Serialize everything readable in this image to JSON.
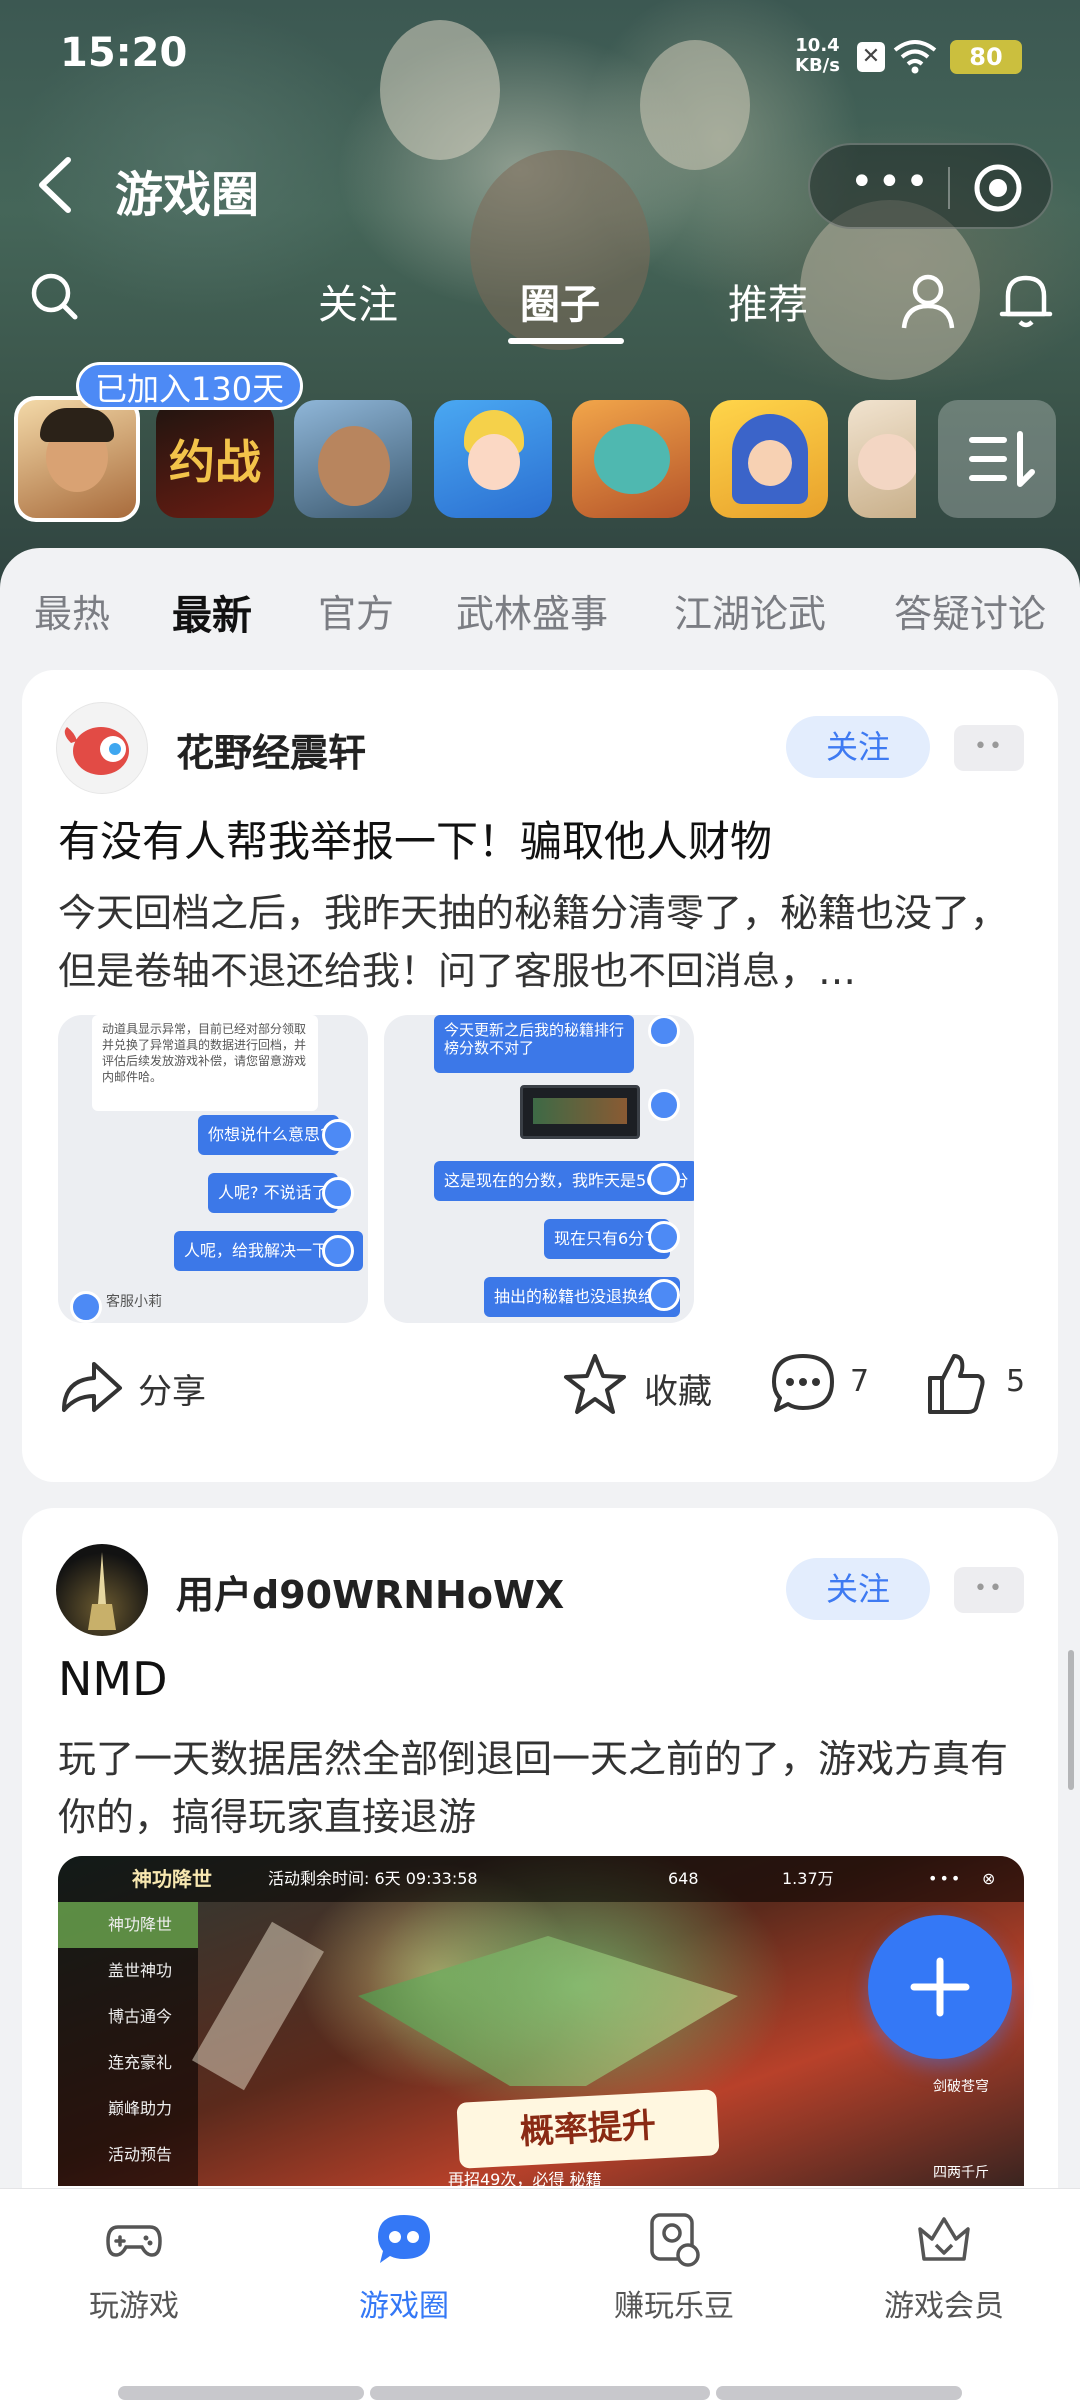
{
  "status_bar": {
    "time": "15:20",
    "net_speed_value": "10.4",
    "net_speed_unit": "KB/s",
    "battery": "80"
  },
  "header": {
    "title": "游戏圈"
  },
  "top_tabs": [
    {
      "label": "关注",
      "active": false
    },
    {
      "label": "圈子",
      "active": true
    },
    {
      "label": "推荐",
      "active": false
    }
  ],
  "joined_badge": "已加入130天",
  "game_icons": [
    {
      "name": "game-icon-1",
      "selected": true
    },
    {
      "name": "game-icon-2",
      "text": "约战"
    },
    {
      "name": "game-icon-3"
    },
    {
      "name": "game-icon-4"
    },
    {
      "name": "game-icon-5"
    },
    {
      "name": "game-icon-6"
    },
    {
      "name": "game-icon-7"
    }
  ],
  "categories": [
    {
      "label": "最热",
      "active": false
    },
    {
      "label": "最新",
      "active": true
    },
    {
      "label": "官方",
      "active": false
    },
    {
      "label": "武林盛事",
      "active": false
    },
    {
      "label": "江湖论武",
      "active": false
    },
    {
      "label": "答疑讨论",
      "active": false
    }
  ],
  "posts": [
    {
      "username": "花野经震轩",
      "follow_label": "关注",
      "title": "有没有人帮我举报一下！骗取他人财物",
      "body": "今天回档之后，我昨天抽的秘籍分清零了，秘籍也没了，但是卷轴不退还给我！问了客服也不回消息，…",
      "thumb1": {
        "top_text": "动道具显示异常，目前已经对部分领取并兑换了异常道具的数据进行回档，并评估后续发放游戏补偿，请您留意游戏内邮件哈。",
        "msgs": [
          "你想说什么意思?",
          "人呢? 不说话了",
          "人呢，给我解决一下啊?"
        ],
        "footer": "客服小莉"
      },
      "thumb2": {
        "msgs": [
          "今天更新之后我的秘籍排行榜分数不对了",
          "这是现在的分数，我昨天是50多分",
          "现在只有6分了",
          "抽出的秘籍也没退换给我"
        ]
      },
      "actions": {
        "share": "分享",
        "favorite": "收藏",
        "comments": "7",
        "likes": "5"
      }
    },
    {
      "username": "用户d90WRNHoWX",
      "follow_label": "关注",
      "title": "NMD",
      "body": "玩了一天数据居然全部倒退回一天之前的了，游戏方真有你的，搞得玩家直接退游",
      "shot": {
        "event": "神功降世",
        "timer": "活动剩余时间: 6天 09:33:58",
        "resource1": "648",
        "resource2": "1.37万",
        "menu": [
          "神功降世",
          "盖世神功",
          "博古通今",
          "连充豪礼",
          "巅峰助力",
          "活动预告"
        ],
        "banner": "概率提升",
        "footer": "再招49次，必得 秘籍",
        "right1": "剑破苍穹",
        "right2": "四两千斤"
      }
    }
  ],
  "bottom_nav": [
    {
      "label": "玩游戏",
      "icon": "gamepad-icon",
      "active": false
    },
    {
      "label": "游戏圈",
      "icon": "chat-bubble-icon",
      "active": true
    },
    {
      "label": "赚玩乐豆",
      "icon": "bean-card-icon",
      "active": false
    },
    {
      "label": "游戏会员",
      "icon": "crown-icon",
      "active": false
    }
  ],
  "colors": {
    "accent": "#3478f6",
    "follow_bg": "#e3edfd",
    "badge": "#4d8af5"
  }
}
